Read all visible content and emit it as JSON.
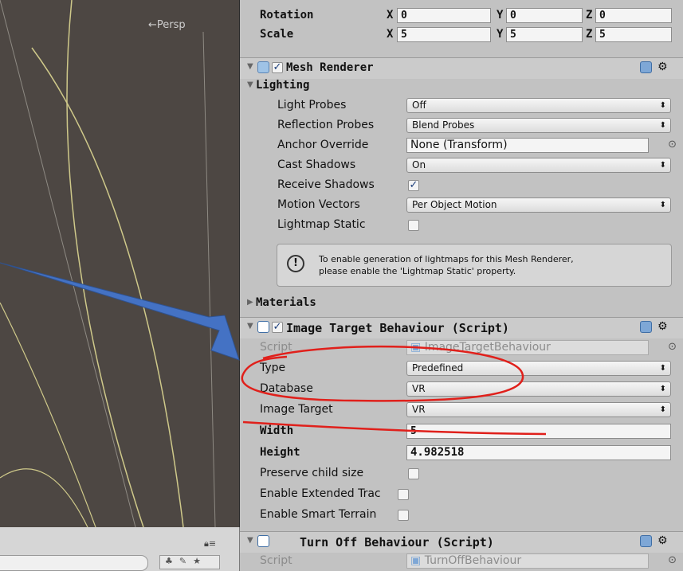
{
  "scene": {
    "persp_label": "←Persp"
  },
  "transform": {
    "rotation": {
      "label": "Rotation",
      "x": "0",
      "y": "0",
      "z": "0"
    },
    "scale": {
      "label": "Scale",
      "x": "5",
      "y": "5",
      "z": "5"
    },
    "axis": {
      "x": "X",
      "y": "Y",
      "z": "Z"
    }
  },
  "mesh_renderer": {
    "title": "Mesh Renderer",
    "lighting_label": "Lighting",
    "light_probes": {
      "label": "Light Probes",
      "value": "Off"
    },
    "reflection_probes": {
      "label": "Reflection Probes",
      "value": "Blend Probes"
    },
    "anchor_override": {
      "label": "Anchor Override",
      "value": "None (Transform)"
    },
    "cast_shadows": {
      "label": "Cast Shadows",
      "value": "On"
    },
    "receive_shadows": {
      "label": "Receive Shadows",
      "checked": true
    },
    "motion_vectors": {
      "label": "Motion Vectors",
      "value": "Per Object Motion"
    },
    "lightmap_static": {
      "label": "Lightmap Static",
      "checked": false
    },
    "help_line1": "To enable generation of lightmaps for this Mesh Renderer,",
    "help_line2": "please enable the 'Lightmap Static' property.",
    "materials_label": "Materials"
  },
  "image_target": {
    "title": "Image Target Behaviour (Script)",
    "script": {
      "label": "Script",
      "value": "ImageTargetBehaviour"
    },
    "type": {
      "label": "Type",
      "value": "Predefined"
    },
    "database": {
      "label": "Database",
      "value": "VR"
    },
    "image_target": {
      "label": "Image Target",
      "value": "VR"
    },
    "width": {
      "label": "Width",
      "value": "5"
    },
    "height": {
      "label": "Height",
      "value": "4.982518"
    },
    "preserve_child_size": {
      "label": "Preserve child size"
    },
    "extended_tracking": {
      "label": "Enable Extended Trac"
    },
    "smart_terrain": {
      "label": "Enable Smart Terrain"
    }
  },
  "turn_off": {
    "title": "Turn Off Behaviour (Script)",
    "script": {
      "label": "Script",
      "value": "TurnOffBehaviour"
    }
  },
  "colors": {
    "annotation_red": "#e0201b",
    "arrow_blue": "#4472c4"
  }
}
